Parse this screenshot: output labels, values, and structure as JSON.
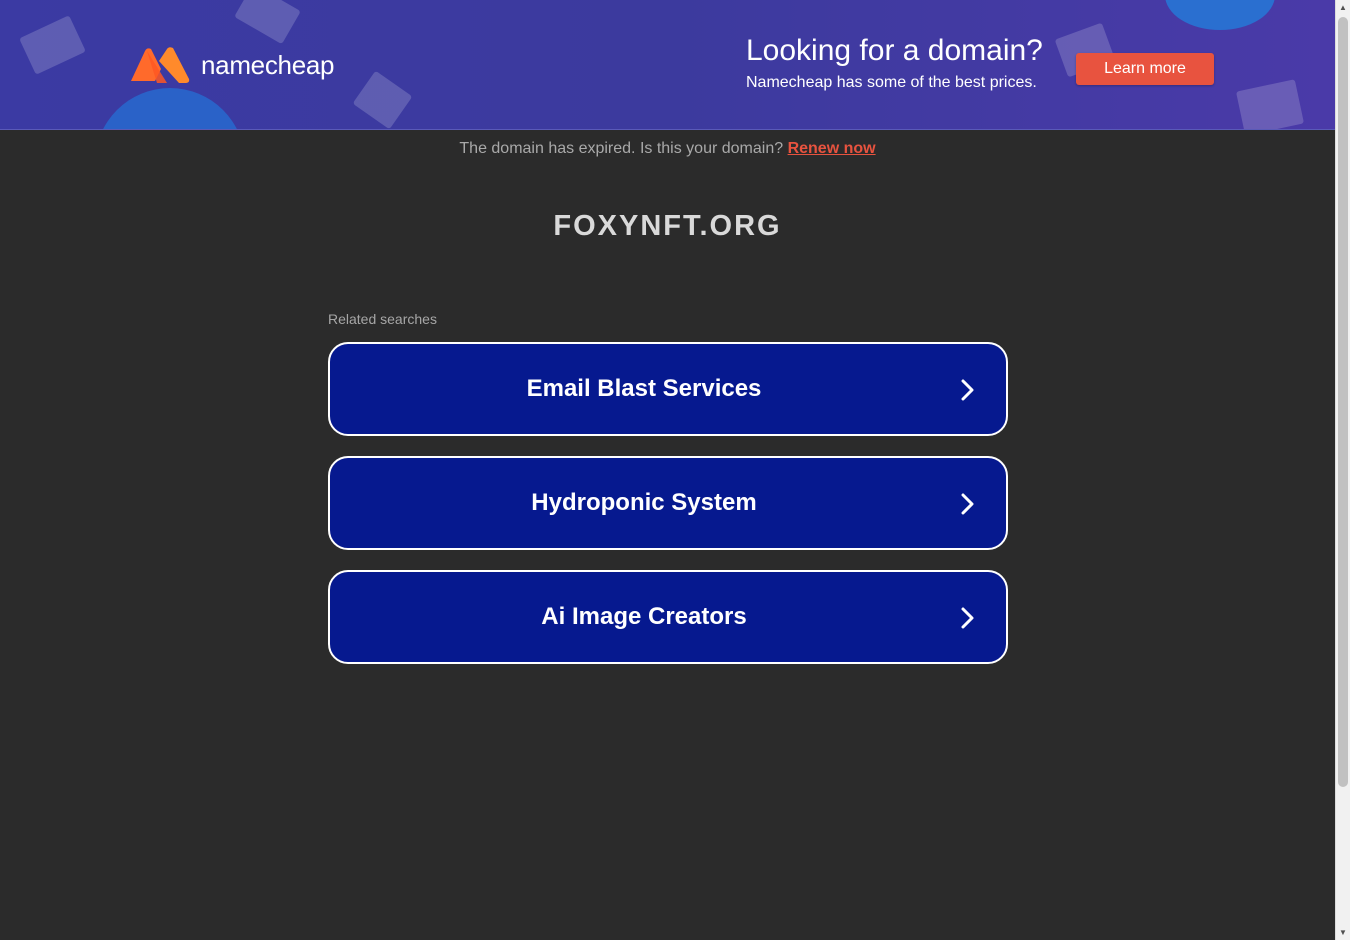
{
  "banner": {
    "brand_name": "namecheap",
    "headline": "Looking for a domain?",
    "subheadline": "Namecheap has some of the best prices.",
    "cta_label": "Learn more",
    "logo_icon": "namecheap-logo-icon",
    "cta_color": "#e8533f"
  },
  "notice": {
    "text": "The domain has expired. Is this your domain?",
    "link_label": "Renew now"
  },
  "domain": {
    "name": "FOXYNFT.ORG"
  },
  "related": {
    "heading": "Related searches",
    "items": [
      {
        "label": "Email Blast Services",
        "icon": "chevron-right-icon"
      },
      {
        "label": "Hydroponic System",
        "icon": "chevron-right-icon"
      },
      {
        "label": "Ai Image Creators",
        "icon": "chevron-right-icon"
      }
    ]
  },
  "colors": {
    "page_background": "#2b2b2b",
    "banner_background": "#3b3aa3",
    "search_button": "#06198f",
    "accent": "#e8533f"
  }
}
